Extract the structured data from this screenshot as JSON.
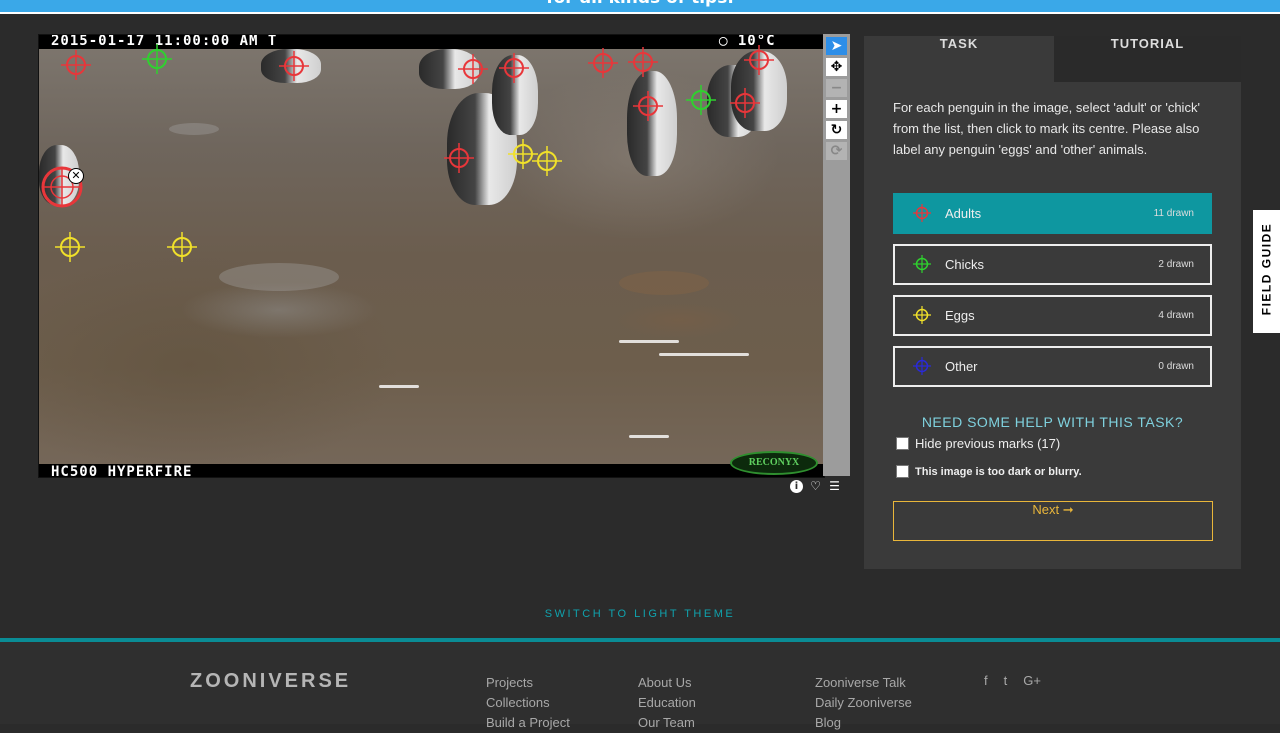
{
  "banner": {
    "text": "for all kinds of tips."
  },
  "subject": {
    "timestamp": "2015-01-17  11:00:00 AM   T",
    "temperature": "◯  10°C",
    "camera_model": "HC500 HYPERFIRE",
    "brand_logo": "RECONYX",
    "selected_mark_close": "✕"
  },
  "tools": {
    "pointer": "➤",
    "move": "✥",
    "zoom_out": "−",
    "zoom_in": "+",
    "rotate": "↻",
    "reset": "⟳"
  },
  "meta_icons": {
    "info": "i",
    "favorite": "♡",
    "collect": "☰"
  },
  "task_panel": {
    "tabs": [
      {
        "label": "TASK"
      },
      {
        "label": "TUTORIAL"
      }
    ],
    "instructions": "For each penguin in the image, select 'adult' or 'chick' from the list, then click to mark its centre. Please also label any penguin 'eggs' and 'other' animals.",
    "choices": [
      {
        "label": "Adults",
        "count": "11 drawn",
        "color": "#e8363a"
      },
      {
        "label": "Chicks",
        "count": "2 drawn",
        "color": "#2fd12f"
      },
      {
        "label": "Eggs",
        "count": "4 drawn",
        "color": "#f1e12a"
      },
      {
        "label": "Other",
        "count": "0 drawn",
        "color": "#2a2ad8"
      }
    ],
    "help_heading": "NEED SOME HELP WITH THIS TASK?",
    "hide_marks_label": "Hide previous marks (17)",
    "too_dark_label": "This image is too dark or blurry.",
    "next_label": "Next ➞"
  },
  "field_guide": {
    "label": "FIELD GUIDE"
  },
  "theme_switch": {
    "label": "SWITCH TO LIGHT THEME"
  },
  "footer": {
    "logo": "ZOONIVERSE",
    "col1": [
      "Projects",
      "Collections",
      "Build a Project"
    ],
    "col2": [
      "About Us",
      "Education",
      "Our Team"
    ],
    "col3": [
      "Zooniverse Talk",
      "Daily Zooniverse",
      "Blog"
    ],
    "social": [
      "f",
      "t",
      "G+"
    ]
  }
}
